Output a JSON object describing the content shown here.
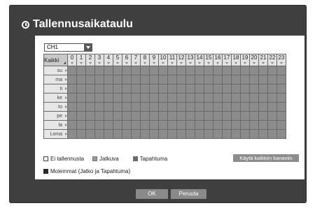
{
  "window": {
    "title": "Tallennusaikataulu"
  },
  "channel": {
    "selected": "CH1"
  },
  "schedule": {
    "corner_label": "Kaikki",
    "hours": [
      "0",
      "1",
      "2",
      "3",
      "4",
      "5",
      "6",
      "7",
      "8",
      "9",
      "10",
      "11",
      "12",
      "13",
      "14",
      "15",
      "16",
      "17",
      "18",
      "19",
      "20",
      "21",
      "22",
      "23"
    ],
    "days": [
      "su",
      "ma",
      "ti",
      "ke",
      "to",
      "pe",
      "la",
      "Loma"
    ]
  },
  "legend": {
    "none": "Ei tallennusta",
    "continuous": "Jatkuva",
    "event": "Tapahtuma",
    "both": "Molemmat (Jatko ja Tapahtuma)"
  },
  "actions": {
    "apply_all": "Käytä kaikkiin kanaviin",
    "ok": "OK",
    "cancel": "Peruuta"
  }
}
